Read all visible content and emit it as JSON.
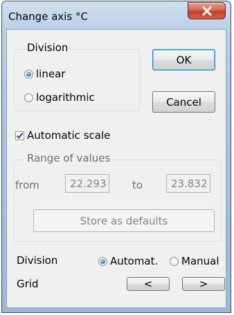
{
  "window": {
    "title": "Change axis °C",
    "close_icon": "close-x-icon"
  },
  "division_group": {
    "legend": "Division",
    "options": [
      {
        "label": "linear",
        "selected": true
      },
      {
        "label": "logarithmic",
        "selected": false
      }
    ]
  },
  "buttons": {
    "ok_label": "OK",
    "cancel_label": "Cancel",
    "store_defaults_label": "Store as defaults",
    "prev_label": "<",
    "next_label": ">"
  },
  "automatic_scale": {
    "label": "Automatic scale",
    "checked": true
  },
  "range_group": {
    "legend": "Range of values",
    "from_label": "from",
    "from_value": "22.293",
    "to_label": "to",
    "to_value": "23.832"
  },
  "division_row": {
    "label": "Division",
    "options": [
      {
        "label": "Automat.",
        "selected": true
      },
      {
        "label": "Manual",
        "selected": false
      }
    ]
  },
  "grid_row": {
    "label": "Grid"
  },
  "colors": {
    "accent": "#2b85c9",
    "close_button": "#c4402a",
    "default_button_border": "#3c7fb1"
  }
}
